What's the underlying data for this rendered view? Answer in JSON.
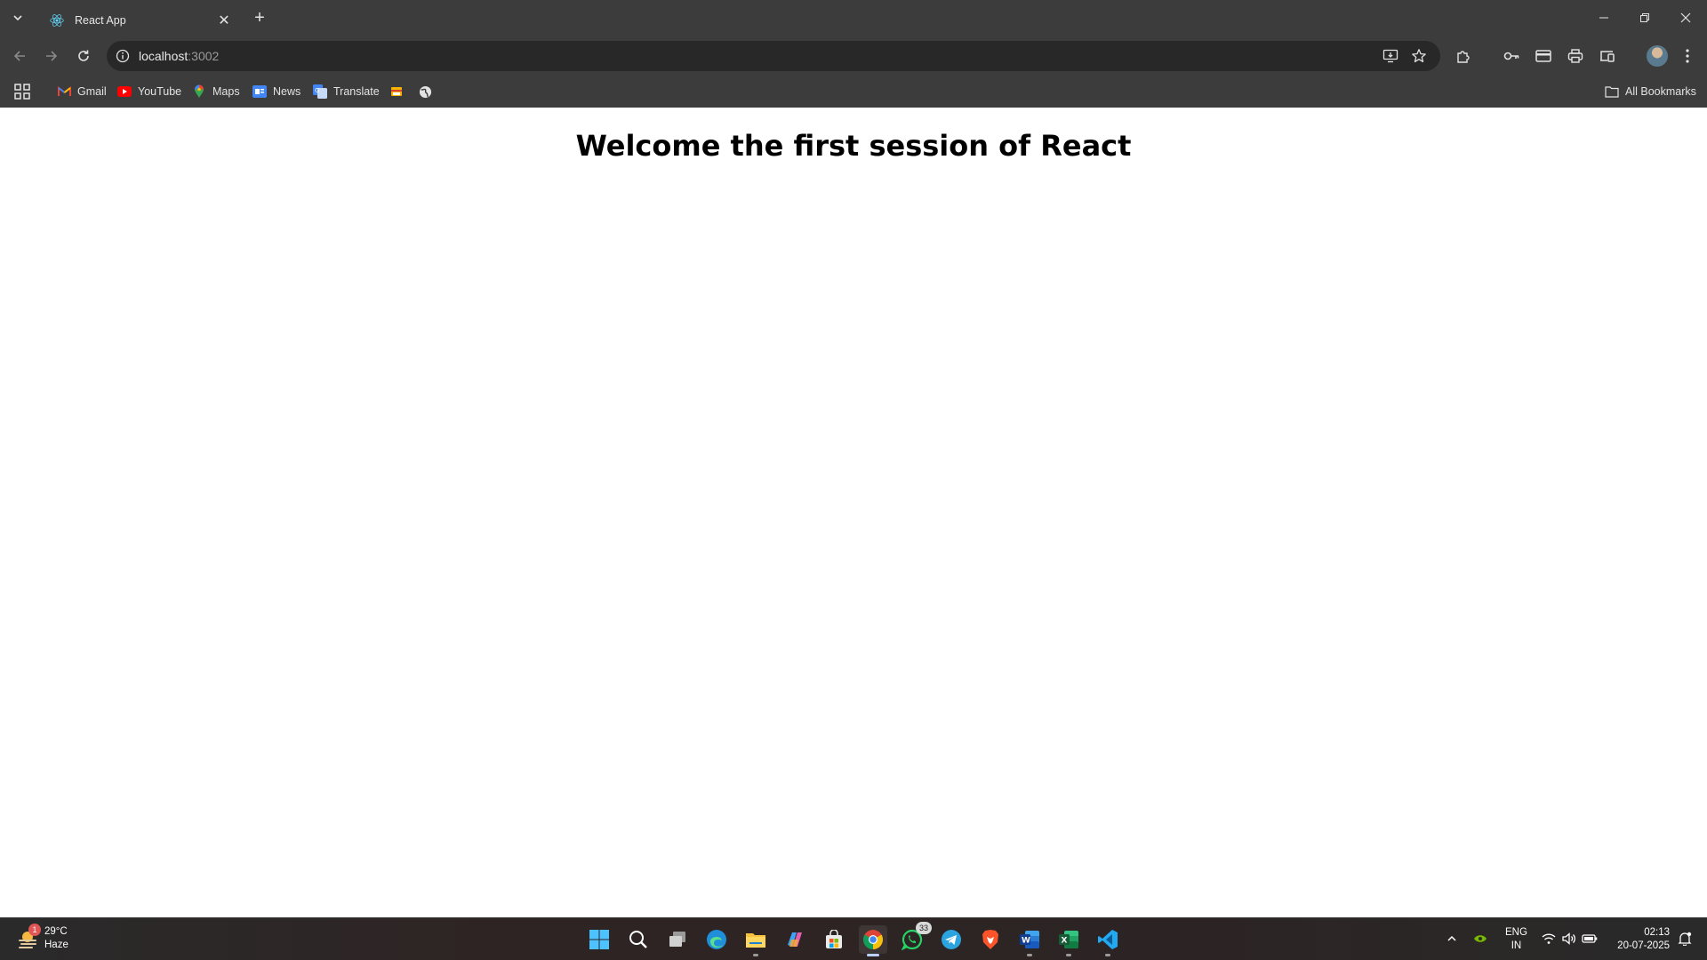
{
  "browser": {
    "tab": {
      "title": "React App",
      "favicon": "react-icon"
    },
    "address": {
      "host": "localhost",
      "port": ":3002"
    },
    "bookmarks": [
      {
        "label": "Gmail",
        "icon": "gmail-icon"
      },
      {
        "label": "YouTube",
        "icon": "youtube-icon"
      },
      {
        "label": "Maps",
        "icon": "maps-icon"
      },
      {
        "label": "News",
        "icon": "news-icon"
      },
      {
        "label": "Translate",
        "icon": "translate-icon"
      }
    ],
    "all_bookmarks_label": "All Bookmarks"
  },
  "page": {
    "heading": "Welcome the first session of React"
  },
  "taskbar": {
    "weather": {
      "temp": "29°C",
      "condition": "Haze",
      "badge": "1"
    },
    "whatsapp_badge": "33",
    "language": {
      "line1": "ENG",
      "line2": "IN"
    },
    "clock": {
      "time": "02:13",
      "date": "20-07-2025"
    }
  },
  "colors": {
    "chrome_bg": "#3c3c3c",
    "omnibox_bg": "#282828",
    "page_bg": "#ffffff",
    "heading": "#000000"
  }
}
